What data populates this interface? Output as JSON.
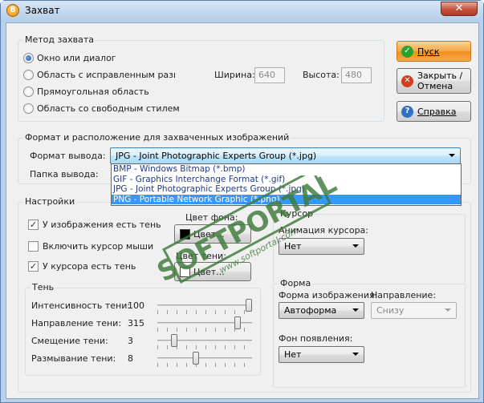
{
  "window": {
    "title": "Захват",
    "app_icon": "8",
    "close": "✕"
  },
  "capture_method": {
    "title": "Метод захвата",
    "options": [
      {
        "label": "Окно или диалог",
        "selected": true
      },
      {
        "label": "Область с исправленным размером",
        "selected": false
      },
      {
        "label": "Прямоугольная область",
        "selected": false
      },
      {
        "label": "Область со свободным стилем",
        "selected": false
      }
    ],
    "width_label": "Ширина:",
    "width_value": "640",
    "height_label": "Высота:",
    "height_value": "480"
  },
  "buttons": {
    "start": "Пуск",
    "close_cancel_1": "Закрыть /",
    "close_cancel_2": "Отмена",
    "help": "Справка"
  },
  "format_section": {
    "title": "Формат и расположение для захваченных изображений",
    "format_label": "Формат вывода:",
    "format_value": "JPG - Joint Photographic Experts Group (*.jpg)",
    "folder_label": "Папка вывода:",
    "format_options": [
      {
        "label": "BMP - Windows Bitmap (*.bmp)",
        "selected": false
      },
      {
        "label": "GIF - Graphics Interchange Format (*.gif)",
        "selected": false
      },
      {
        "label": "JPG - Joint Photographic Experts Group (*.jpg)",
        "selected": false
      },
      {
        "label": "PNG - Portable Network Graphic (*.png)",
        "selected": true
      }
    ]
  },
  "settings": {
    "title": "Настройки",
    "image_shadow": {
      "label": "У изображения есть тень",
      "checked": true
    },
    "include_cursor": {
      "label": "Включить курсор мыши",
      "checked": false
    },
    "cursor_shadow": {
      "label": "У курсора есть тень",
      "checked": true
    },
    "bg_color_label": "Цвет фона:",
    "bg_color_button": "Цвет...",
    "bg_color": "#000000",
    "shadow_color_label": "Цвет тени:",
    "shadow_color_button": "Цвет...",
    "shadow_color": "#ffffff"
  },
  "shadow": {
    "title": "Тень",
    "rows": [
      {
        "label": "Интенсивность тени:",
        "value": "100",
        "fraction": 1.0
      },
      {
        "label": "Направление тени:",
        "value": "315",
        "fraction": 0.875
      },
      {
        "label": "Смещение тени:",
        "value": "3",
        "fraction": 0.15
      },
      {
        "label": "Размывание тени:",
        "value": "8",
        "fraction": 0.4
      }
    ]
  },
  "cursor": {
    "title": "Курсор",
    "animation_label": "Анимация курсора:",
    "animation_value": "Нет"
  },
  "shape": {
    "title": "Форма",
    "image_shape_label": "Форма изображения:",
    "image_shape_value": "Автоформа",
    "direction_label": "Направление:",
    "direction_value": "Снизу",
    "appear_bg_label": "Фон появления:",
    "appear_bg_value": "Нет"
  },
  "watermark": {
    "brand": "SOFTPORTAL",
    "url": "www.softportal.com",
    "tm": "TM"
  },
  "colors": {
    "start_button": "#f7a64a",
    "selection": "#3399ff",
    "check_icon": "#2ea02e",
    "close_icon": "#d04020",
    "help_icon": "#2f6fc4"
  }
}
